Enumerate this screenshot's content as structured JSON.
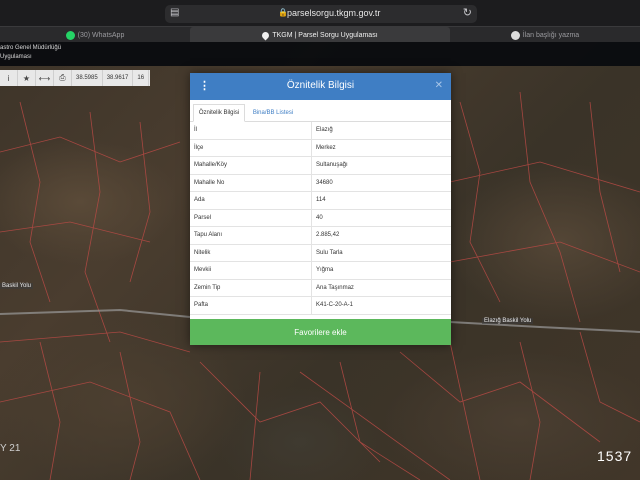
{
  "browser": {
    "url": "parselsorgu.tkgm.gov.tr",
    "tabs": [
      {
        "label": "(30) WhatsApp"
      },
      {
        "label": "TKGM | Parsel Sorgu Uygulaması"
      },
      {
        "label": "İlan başlığı yazma"
      }
    ]
  },
  "map": {
    "header_line1": "astro Genel Müdürlüğü",
    "header_line2": "Uygulaması",
    "toolbar": {
      "coord_x": "38.5985",
      "coord_y": "38.9617",
      "zoom": "16"
    },
    "road_labels": [
      "Baskil Yolu",
      "Elazığ Baskil Yolu"
    ],
    "year_label": "Y 21",
    "corner_number": "1537"
  },
  "dialog": {
    "title": "Öznitelik Bilgisi",
    "tabs": [
      "Öznitelik Bilgisi",
      "Bina/BB Listesi"
    ],
    "rows": [
      {
        "key": "İl",
        "value": "Elazığ"
      },
      {
        "key": "İlçe",
        "value": "Merkez"
      },
      {
        "key": "Mahalle/Köy",
        "value": "Sultanuşağı"
      },
      {
        "key": "Mahalle No",
        "value": "34680"
      },
      {
        "key": "Ada",
        "value": "114"
      },
      {
        "key": "Parsel",
        "value": "40"
      },
      {
        "key": "Tapu Alanı",
        "value": "2.885,42"
      },
      {
        "key": "Nitelik",
        "value": "Sulu Tarla"
      },
      {
        "key": "Mevkii",
        "value": "Yığma"
      },
      {
        "key": "Zemin Tip",
        "value": "Ana Taşınmaz"
      },
      {
        "key": "Pafta",
        "value": "K41-C-20-A-1"
      }
    ],
    "favorite_button": "Favorilere ekle"
  }
}
